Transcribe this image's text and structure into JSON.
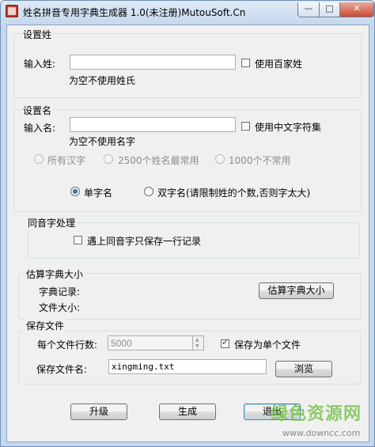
{
  "window": {
    "title": "姓名拼音专用字典生成器 1.0(未注册)MutouSoft.Cn",
    "min": "—",
    "max": "□",
    "close": "✕"
  },
  "surname": {
    "group_title": "设置姓",
    "input_label": "输入姓:",
    "input_value": "",
    "use_baijiaxing": "使用百家姓",
    "hint": "为空不使用姓氏"
  },
  "givenname": {
    "group_title": "设置名",
    "input_label": "输入名:",
    "input_value": "",
    "use_chinese_charset": "使用中文字符集",
    "hint": "为空不使用名字",
    "range_options": [
      "所有汉字",
      "2500个姓名最常用",
      "1000个不常用"
    ],
    "single_char": "单字名",
    "double_char": "双字名(请限制姓的个数,否则字太大)"
  },
  "homophone": {
    "group_title": "同音字处理",
    "keep_one": "遇上同音字只保存一行记录"
  },
  "estimate": {
    "group_title": "估算字典大小",
    "records_label": "字典记录:",
    "size_label": "文件大小:",
    "button": "估算字典大小"
  },
  "save": {
    "group_title": "保存文件",
    "lines_label": "每个文件行数:",
    "lines_value": "5000",
    "single_file": "保存为单个文件",
    "filename_label": "保存文件名:",
    "filename_value": "xingming.txt",
    "browse": "浏览"
  },
  "buttons": {
    "upgrade": "升级",
    "generate": "生成",
    "exit": "退出"
  },
  "watermark": {
    "brand": "绿色资源网",
    "url": "www.downcc.com"
  }
}
